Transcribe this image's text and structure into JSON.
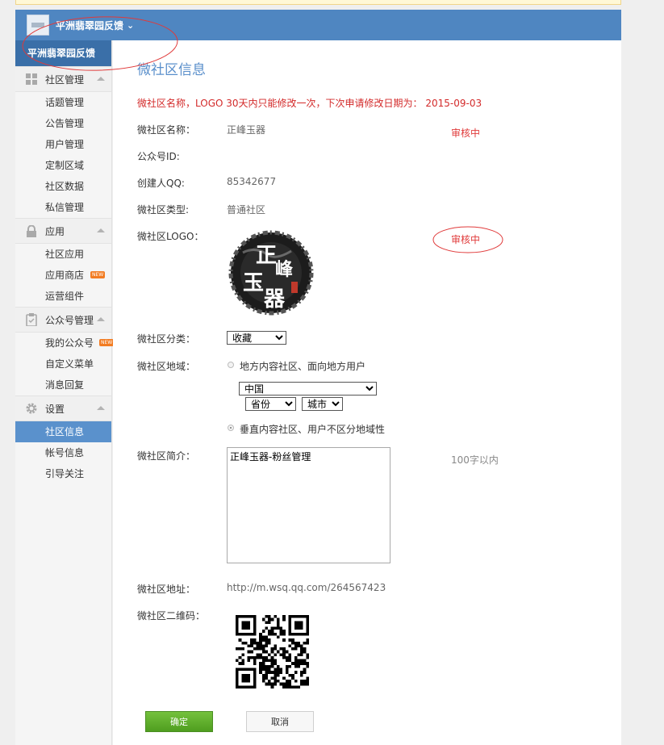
{
  "header": {
    "account_name": "平洲翡翠园反馈",
    "switch_icon": "chevron-down-icon"
  },
  "sidebar": {
    "current_account": "平洲翡翠园反馈",
    "groups": [
      {
        "title": "社区管理",
        "icon": "grid-icon",
        "items": [
          "话题管理",
          "公告管理",
          "用户管理",
          "定制区域",
          "社区数据",
          "私信管理"
        ]
      },
      {
        "title": "应用",
        "icon": "lock-icon",
        "items": [
          "社区应用",
          "应用商店",
          "运营组件"
        ]
      },
      {
        "title": "公众号管理",
        "icon": "clipboard-icon",
        "items": [
          "我的公众号",
          "自定义菜单",
          "消息回复"
        ]
      },
      {
        "title": "设置",
        "icon": "gear-icon",
        "items": [
          "社区信息",
          "帐号信息",
          "引导关注"
        ]
      }
    ],
    "new_badge": "NEW"
  },
  "main": {
    "title": "微社区信息",
    "warning": "微社区名称，LOGO 30天内只能修改一次，下次申请修改日期为： 2015-09-03",
    "fields": {
      "name_label": "微社区名称：",
      "name_value": "正峰玉器",
      "name_status": "审核中",
      "account_id_label": "公众号ID:",
      "creator_qq_label": "创建人QQ:",
      "creator_qq_value": "85342677",
      "type_label": "微社区类型:",
      "type_value": "普通社区",
      "logo_label": "微社区LOGO：",
      "logo_status": "审核中",
      "logo_text": "正峰玉器",
      "category_label": "微社区分类：",
      "category_value": "收藏",
      "region_label": "微社区地域：",
      "region_option_local": "地方内容社区、面向地方用户",
      "country_value": "中国",
      "province_value": "省份",
      "city_value": "城市",
      "region_option_vertical": "垂直内容社区、用户不区分地域性",
      "intro_label": "微社区简介：",
      "intro_value": "正峰玉器-粉丝管理",
      "intro_hint": "100字以内",
      "address_label": "微社区地址：",
      "address_value": "http://m.wsq.qq.com/264567423",
      "qrcode_label": "微社区二维码："
    },
    "buttons": {
      "ok": "确定",
      "cancel": "取消"
    }
  },
  "colors": {
    "header": "#4f86c1",
    "active_nav": "#5a91cc",
    "title": "#5a8fcb",
    "warning": "#d32a2a",
    "annotation": "#e03a3a",
    "ok_button": "#5ea82a"
  }
}
